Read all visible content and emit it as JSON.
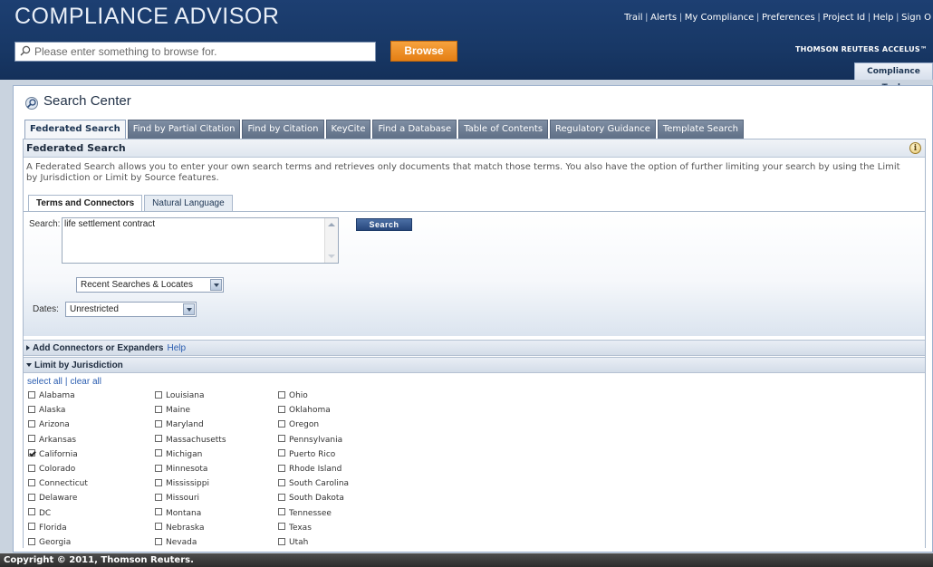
{
  "header": {
    "app_title": "COMPLIANCE ADVISOR",
    "links": [
      "Trail",
      "Alerts",
      "My Compliance",
      "Preferences",
      "Project Id",
      "Help",
      "Sign O"
    ],
    "search_placeholder": "Please enter something to browse for.",
    "browse_label": "Browse",
    "brand": "THOMSON REUTERS ACCELUS™",
    "compliance_tools_tab": "Compliance Tools"
  },
  "search_center": {
    "title": "Search Center",
    "tabs": [
      "Federated Search",
      "Find by Partial Citation",
      "Find by Citation",
      "KeyCite",
      "Find a Database",
      "Table of Contents",
      "Regulatory Guidance",
      "Template Search"
    ],
    "active_tab": "Federated Search"
  },
  "federated": {
    "header": "Federated Search",
    "description": "A Federated Search allows you to enter your own search terms and retrieves only documents that match those terms. You also have the option of further limiting your search by using the Limit by Jurisdiction or Limit by Source features.",
    "sub_tabs": [
      "Terms and Connectors",
      "Natural Language"
    ],
    "search_label": "Search:",
    "search_value": "life settlement contract",
    "search_button": "Search",
    "recent_searches": "Recent Searches & Locates",
    "dates_label": "Dates:",
    "dates_value": "Unrestricted",
    "add_connectors": "Add Connectors or Expanders",
    "help_link": "Help",
    "limit_jurisdiction": "Limit by Jurisdiction",
    "select_all": "select all",
    "clear_all": "clear all"
  },
  "jurisdictions": {
    "col1": [
      {
        "name": "Alabama",
        "checked": false
      },
      {
        "name": "Alaska",
        "checked": false
      },
      {
        "name": "Arizona",
        "checked": false
      },
      {
        "name": "Arkansas",
        "checked": false
      },
      {
        "name": "California",
        "checked": true
      },
      {
        "name": "Colorado",
        "checked": false
      },
      {
        "name": "Connecticut",
        "checked": false
      },
      {
        "name": "Delaware",
        "checked": false
      },
      {
        "name": "DC",
        "checked": false
      },
      {
        "name": "Florida",
        "checked": false
      },
      {
        "name": "Georgia",
        "checked": false
      }
    ],
    "col2": [
      {
        "name": "Louisiana",
        "checked": false
      },
      {
        "name": "Maine",
        "checked": false
      },
      {
        "name": "Maryland",
        "checked": false
      },
      {
        "name": "Massachusetts",
        "checked": false
      },
      {
        "name": "Michigan",
        "checked": false
      },
      {
        "name": "Minnesota",
        "checked": false
      },
      {
        "name": "Mississippi",
        "checked": false
      },
      {
        "name": "Missouri",
        "checked": false
      },
      {
        "name": "Montana",
        "checked": false
      },
      {
        "name": "Nebraska",
        "checked": false
      },
      {
        "name": "Nevada",
        "checked": false
      }
    ],
    "col3": [
      {
        "name": "Ohio",
        "checked": false
      },
      {
        "name": "Oklahoma",
        "checked": false
      },
      {
        "name": "Oregon",
        "checked": false
      },
      {
        "name": "Pennsylvania",
        "checked": false
      },
      {
        "name": "Puerto Rico",
        "checked": false
      },
      {
        "name": "Rhode Island",
        "checked": false
      },
      {
        "name": "South Carolina",
        "checked": false
      },
      {
        "name": "South Dakota",
        "checked": false
      },
      {
        "name": "Tennessee",
        "checked": false
      },
      {
        "name": "Texas",
        "checked": false
      },
      {
        "name": "Utah",
        "checked": false
      }
    ]
  },
  "footer": {
    "copyright": "Copyright © 2011, Thomson Reuters."
  }
}
